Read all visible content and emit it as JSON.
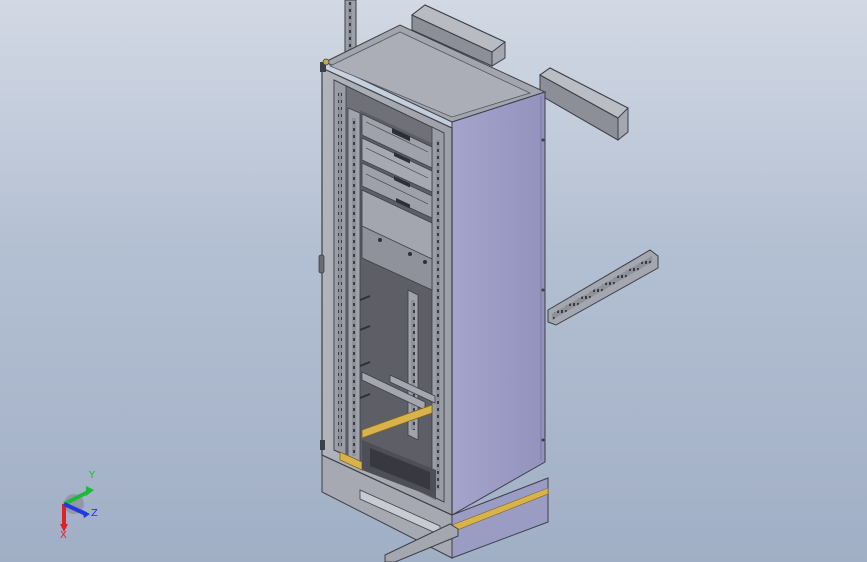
{
  "viewport": {
    "background_top": "#d2d9e4",
    "background_bottom": "#a1afc6"
  },
  "model": {
    "object": "electrical-cabinet-rack-assembly",
    "colors": {
      "body": "#a9acc4",
      "side_panel": "#9b9cc6",
      "top_panel": "#a5a7b0",
      "frame": "#9a9ca6",
      "edge": "#3d3f47",
      "rail_accent": "#d8b24a",
      "interior": "#6f7078"
    }
  },
  "triad": {
    "x_label": "X",
    "y_label": "Y",
    "z_label": "Z",
    "x_color": "#e0202a",
    "y_color": "#1fb83a",
    "z_color": "#2238e0"
  }
}
